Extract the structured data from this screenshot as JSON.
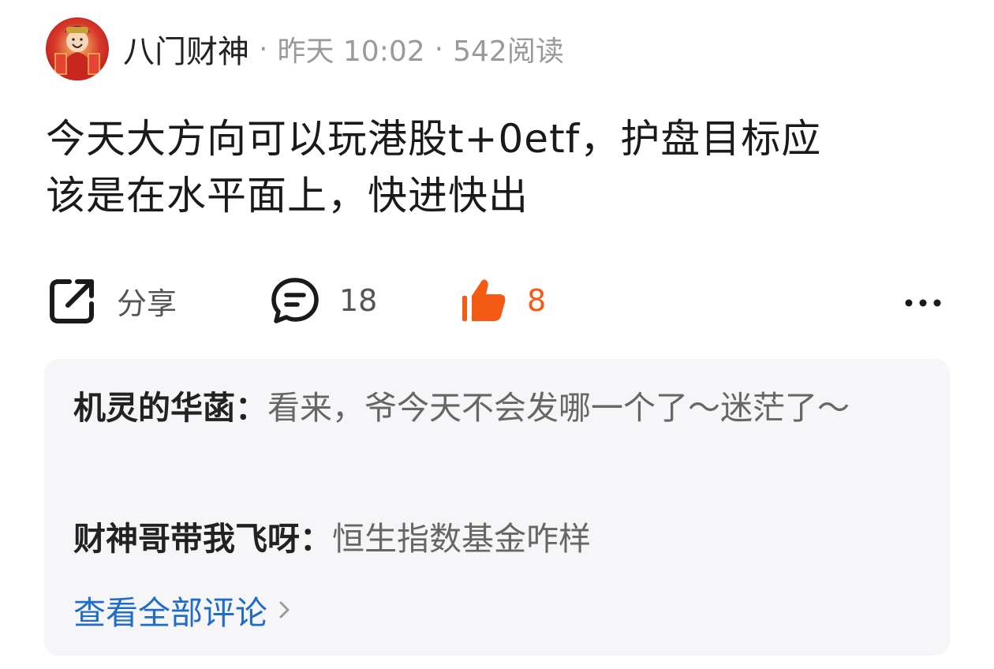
{
  "post": {
    "author": "八门财神",
    "time": "昨天 10:02",
    "reads": "542阅读",
    "separator": "·",
    "text_lines": [
      "今天大方向可以玩港股t+0etf，护盘目标应",
      "该是在水平面上，快进快出"
    ]
  },
  "actions": {
    "share_label": "分享",
    "comment_count": "18",
    "like_count": "8",
    "like_color": "#f35a14"
  },
  "comments": {
    "items": [
      {
        "name": "机灵的华菡：",
        "text": "看来，爷今天不会发哪一个了～迷茫了～"
      },
      {
        "name": "财神哥带我飞呀：",
        "text": "恒生指数基金咋样"
      }
    ],
    "view_all_label": "查看全部评论",
    "link_color": "#1f6cc9"
  },
  "icons": {
    "avatar": "avatar-image",
    "share": "share-icon",
    "comment": "comment-icon",
    "like": "thumbs-up-icon",
    "more": "more-icon",
    "chevron": "chevron-right-icon"
  }
}
